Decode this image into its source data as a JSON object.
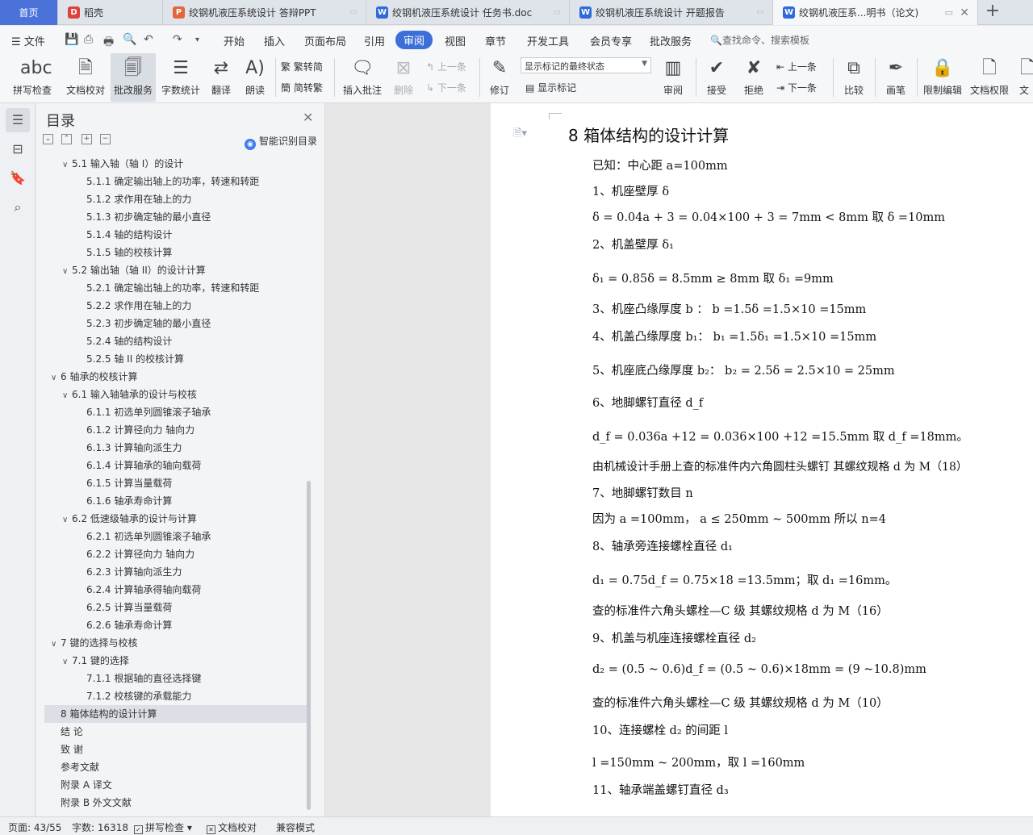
{
  "tabs": [
    {
      "label": "首页",
      "type": "home"
    },
    {
      "label": "稻壳",
      "icon": "daoke-icon"
    },
    {
      "label": "绞钢机液压系统设计 答辩PPT",
      "icon": "ppt-icon"
    },
    {
      "label": "绞钢机液压系统设计 任务书.doc",
      "icon": "word-icon"
    },
    {
      "label": "绞钢机液压系统设计 开题报告",
      "icon": "word-icon"
    },
    {
      "label": "绞钢机液压系...明书（论文)",
      "icon": "word-icon",
      "active": true
    }
  ],
  "menu": {
    "file": "文件",
    "items": [
      "开始",
      "插入",
      "页面布局",
      "引用",
      "审阅",
      "视图",
      "章节",
      "开发工具",
      "会员专享",
      "批改服务"
    ],
    "selected": "审阅",
    "search_placeholder": "查找命令、搜索模板"
  },
  "ribbon": {
    "spell_check": "拼写检查",
    "doc_proofread": "文档校对",
    "grading_service": "批改服务",
    "word_count": "字数统计",
    "translate": "翻译",
    "read_aloud": "朗读",
    "trad_to_simp": "繁转简",
    "simp_to_trad": "简转繁",
    "insert_comment": "插入批注",
    "delete": "删除",
    "prev": "上一条",
    "next": "下一条",
    "revise": "修订",
    "markup_mode": "显示标记的最终状态",
    "show_markup": "显示标记",
    "review": "审阅",
    "accept": "接受",
    "reject": "拒绝",
    "prev2": "上一条",
    "next2": "下一条",
    "compare": "比较",
    "pen": "画笔",
    "restrict_edit": "限制编辑",
    "doc_permission": "文档权限",
    "doc_more": "文"
  },
  "toc": {
    "title": "目录",
    "smart_label": "智能识别目录",
    "items": [
      {
        "label": "5.1  输入轴（轴 I）的设计",
        "level": 2,
        "expanded": true
      },
      {
        "label": "5.1.1  确定输出轴上的功率，转速和转距",
        "level": 3
      },
      {
        "label": "5.1.2    求作用在轴上的力",
        "level": 3
      },
      {
        "label": "5.1.3  初步确定轴的最小直径",
        "level": 3
      },
      {
        "label": "5.1.4  轴的结构设计",
        "level": 3
      },
      {
        "label": "5.1.5  轴的校核计算",
        "level": 3
      },
      {
        "label": "5.2  输出轴（轴 II）的设计计算",
        "level": 2,
        "expanded": true
      },
      {
        "label": "5.2.1  确定输出轴上的功率，转速和转距",
        "level": 3
      },
      {
        "label": "5.2.2  求作用在轴上的力",
        "level": 3
      },
      {
        "label": "5.2.3  初步确定轴的最小直径",
        "level": 3
      },
      {
        "label": "5.2.4  轴的结构设计",
        "level": 3
      },
      {
        "label": "5.2.5  轴 II 的校核计算",
        "level": 3
      },
      {
        "label": "6  轴承的校核计算",
        "level": 1,
        "expanded": true
      },
      {
        "label": "6.1  输入轴轴承的设计与校核",
        "level": 2,
        "expanded": true
      },
      {
        "label": "6.1.1  初选单列圆锥滚子轴承",
        "level": 3
      },
      {
        "label": "6.1.2  计算径向力    轴向力",
        "level": 3
      },
      {
        "label": "6.1.3  计算轴向派生力",
        "level": 3
      },
      {
        "label": "6.1.4  计算轴承的轴向载荷",
        "level": 3
      },
      {
        "label": "6.1.5  计算当量载荷",
        "level": 3
      },
      {
        "label": "6.1.6  轴承寿命计算",
        "level": 3
      },
      {
        "label": "6.2  低速级轴承的设计与计算",
        "level": 2,
        "expanded": true
      },
      {
        "label": "6.2.1  初选单列圆锥滚子轴承",
        "level": 3
      },
      {
        "label": "6.2.2  计算径向力      轴向力",
        "level": 3
      },
      {
        "label": "6.2.3  计算轴向派生力",
        "level": 3
      },
      {
        "label": "6.2.4  计算轴承得轴向载荷",
        "level": 3
      },
      {
        "label": "6.2.5  计算当量载荷",
        "level": 3
      },
      {
        "label": "6.2.6  轴承寿命计算",
        "level": 3
      },
      {
        "label": "7  键的选择与校核",
        "level": 1,
        "expanded": true
      },
      {
        "label": "7.1  键的选择",
        "level": 2,
        "expanded": true
      },
      {
        "label": "7.1.1  根据轴的直径选择键",
        "level": 3
      },
      {
        "label": "7.1.2  校核键的承载能力",
        "level": 3
      },
      {
        "label": "8  箱体结构的设计计算",
        "level": 1,
        "selected": true
      },
      {
        "label": "结    论",
        "level": 1
      },
      {
        "label": "致    谢",
        "level": 1
      },
      {
        "label": "参考文献",
        "level": 1
      },
      {
        "label": "附录 A  译文",
        "level": 1
      },
      {
        "label": "附录 B  外文文献",
        "level": 1
      }
    ]
  },
  "document": {
    "heading": "8  箱体结构的设计计算",
    "lines": [
      "已知：中心距  a=100mm",
      "1、机座壁厚 δ",
      "δ = 0.04a + 3 = 0.04×100 + 3 = 7mm < 8mm                取 δ =10mm",
      "2、机盖壁厚 δ₁",
      "δ₁ = 0.85δ = 8.5mm ≥ 8mm                    取 δ₁ =9mm",
      "3、机座凸缘厚度 b  ：          b =1.5δ =1.5×10 =15mm",
      "4、机盖凸缘厚度 b₁：          b₁ =1.5δ₁ =1.5×10 =15mm",
      "5、机座底凸缘厚度 b₂：        b₂ = 2.5δ = 2.5×10 = 25mm",
      "6、地脚螺钉直径 d_f",
      "d_f = 0.036a +12 = 0.036×100 +12 =15.5mm    取 d_f =18mm。",
      "由机械设计手册上查的标准件内六角圆柱头螺钉      其螺纹规格 d 为 M（18）",
      "7、地脚螺钉数目 n",
      "因为 a =100mm，  a ≤ 250mm ~ 500mm          所以 n=4",
      "8、轴承旁连接螺栓直径 d₁",
      "d₁ = 0.75d_f = 0.75×18 =13.5mm；取 d₁ =16mm。",
      "查的标准件六角头螺栓—C 级    其螺纹规格  d 为 M（16）",
      "9、机盖与机座连接螺栓直径 d₂",
      "d₂ = (0.5 ~ 0.6)d_f = (0.5 ~ 0.6)×18mm = (9 ~10.8)mm",
      "查的标准件六角头螺栓—C 级    其螺纹规格  d 为 M（10）",
      "10、连接螺栓 d₂ 的间距 l",
      "l =150mm ~ 200mm，取 l =160mm",
      "11、轴承端盖螺钉直径 d₃"
    ]
  },
  "status": {
    "page": "页面: 43/55",
    "words": "字数: 16318",
    "spell_check": "拼写检查",
    "doc_proofread": "文档校对",
    "compat_mode": "兼容模式"
  }
}
